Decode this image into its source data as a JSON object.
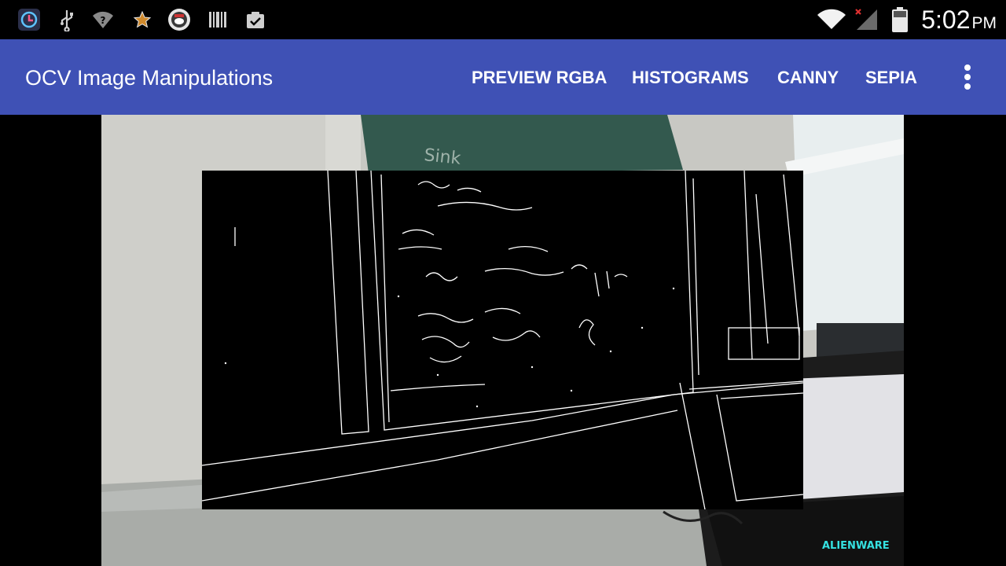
{
  "status_bar": {
    "time": "5:02",
    "ampm": "PM",
    "left_icons": [
      "app-notification-icon",
      "usb-icon",
      "wifi-question-icon",
      "star-icon",
      "app-badge-icon",
      "barcode-icon",
      "clipboard-check-icon"
    ],
    "right_icons": [
      "wifi-icon",
      "signal-no-service-icon",
      "battery-icon"
    ]
  },
  "action_bar": {
    "title": "OCV Image Manipulations",
    "actions": [
      "PREVIEW RGBA",
      "HISTOGRAMS",
      "CANNY",
      "SEPIA"
    ],
    "overflow_icon": "more-vert-icon",
    "color": "#3f51b5"
  },
  "preview": {
    "board_text": "Sink",
    "laptop_brand": "ALIENWARE",
    "overlay_mode": "canny"
  }
}
